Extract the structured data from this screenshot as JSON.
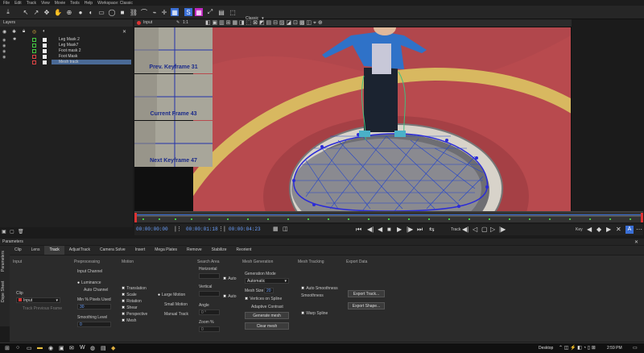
{
  "menu": [
    "File",
    "Edit",
    "Track",
    "View",
    "Movie",
    "Tools",
    "Help",
    "Workspace: Classic"
  ],
  "toolbar": {
    "workspace_select": "Classic"
  },
  "layers": {
    "title": "Layers",
    "items": [
      {
        "label": "Leg Mask 2"
      },
      {
        "label": "Leg Mask7"
      },
      {
        "label": "Foot mask 2"
      },
      {
        "label": "Foot Mask"
      },
      {
        "label": "Mesh track",
        "selected": true
      }
    ]
  },
  "viewer": {
    "input_label": "Input",
    "zoom": "1:1",
    "thumbs": [
      "Prev. Keyframe 31",
      "Current Frame 43",
      "Next Keyframe 47"
    ]
  },
  "timeline": {
    "current_time": "00:00:00:00",
    "in_time": "00:00:01:18",
    "out_time": "00:00:04:23",
    "track_label": "Track",
    "key_label": "Key"
  },
  "params": {
    "title": "Parameters",
    "side_tabs": [
      "Parameters",
      "Dope Sheet"
    ],
    "tabs": [
      "Clip",
      "Lens",
      "Track",
      "AdjustTrack",
      "Camera Solve",
      "Insert",
      "Mega Plates",
      "Remove",
      "Stabilize",
      "Reorient"
    ],
    "active_tab": "Track",
    "input": {
      "header": "Input",
      "clip": "Clip",
      "clip_value": "Input",
      "track_previous": "Track Previous Frame"
    },
    "preprocessing": {
      "header": "Preprocessing",
      "input_channel": "Input Channel",
      "luminance": "Luminance",
      "auto_channel": "Auto Channel",
      "min_pixels": "Min % Pixels Used",
      "min_pixels_value": "30",
      "smoothing": "Smoothing Level",
      "smoothing_value": "0"
    },
    "motion": {
      "header": "Motion",
      "items": [
        "Translation",
        "Scale",
        "Rotation",
        "Shear",
        "Perspective",
        "Mesh"
      ],
      "large_motion": "Large Motion",
      "small_motion": "Small Motion",
      "manual_track": "Manual Track"
    },
    "search": {
      "header": "Search Area",
      "horizontal": "Horizontal",
      "vertical": "Vertical",
      "auto": "Auto",
      "angle": "Angle",
      "angle_value": "0 °",
      "zoom": "Zoom %",
      "zoom_value": "0"
    },
    "mesh_gen": {
      "header": "Mesh Generation",
      "mode": "Generation Mode",
      "mode_value": "Automatic",
      "mesh_size": "Mesh Size",
      "mesh_size_value": "20",
      "vertices": "Vertices on Spline",
      "adaptive": "Adaptive Contrast",
      "generate": "Generate mesh",
      "clear": "Clear mesh"
    },
    "mesh_track": {
      "header": "Mesh Tracking",
      "auto_smooth": "Auto Smoothness",
      "smoothness": "Smoothness",
      "warp": "Warp Spline"
    },
    "export": {
      "header": "Export Data",
      "track": "Export Track...",
      "shape": "Export Shape..."
    }
  },
  "taskbar": {
    "desktop": "Desktop",
    "time": "2:59 PM"
  }
}
